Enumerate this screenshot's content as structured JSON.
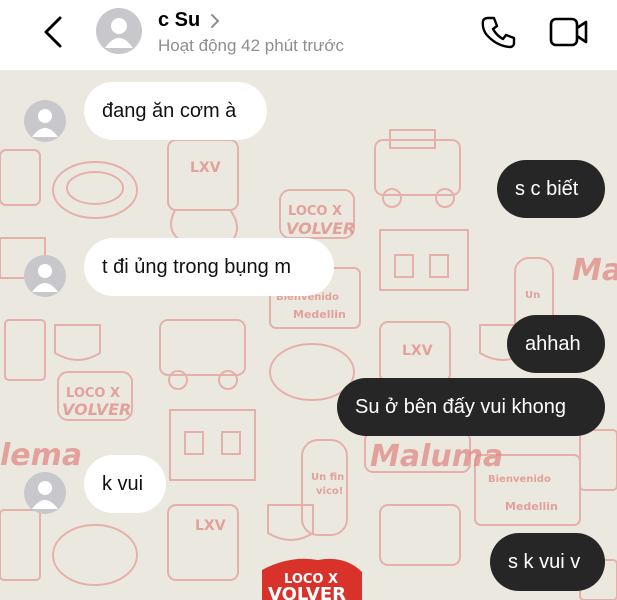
{
  "header": {
    "contact_name": "c Su",
    "status": "Hoạt động 42 phút trước"
  },
  "icons": {
    "back": "chevron-left-icon",
    "name_chevron": "chevron-right-icon",
    "call": "phone-icon",
    "video": "video-camera-icon"
  },
  "colors": {
    "incoming_bubble": "#ffffff",
    "outgoing_bubble": "#262626",
    "wallpaper_bg": "#ebe8df",
    "wallpaper_ink": "#e08a84",
    "sticker_red": "#d8322b"
  },
  "wallpaper_text": [
    "LXV",
    "Bienvenido a Medellin",
    "Maluma",
    "LOCO X VOLVER",
    "Un fin vico!"
  ],
  "messages": [
    {
      "sender": "c Su",
      "text": "đang ăn cơm à"
    },
    {
      "sender": "me",
      "text": "s c biết"
    },
    {
      "sender": "c Su",
      "text": "t đi ủng trong bụng m"
    },
    {
      "sender": "me",
      "text": "ahhah"
    },
    {
      "sender": "me",
      "text": "Su ở bên đấy vui khong"
    },
    {
      "sender": "c Su",
      "text": "k vui"
    },
    {
      "sender": "me",
      "text": "s k vui v"
    }
  ]
}
